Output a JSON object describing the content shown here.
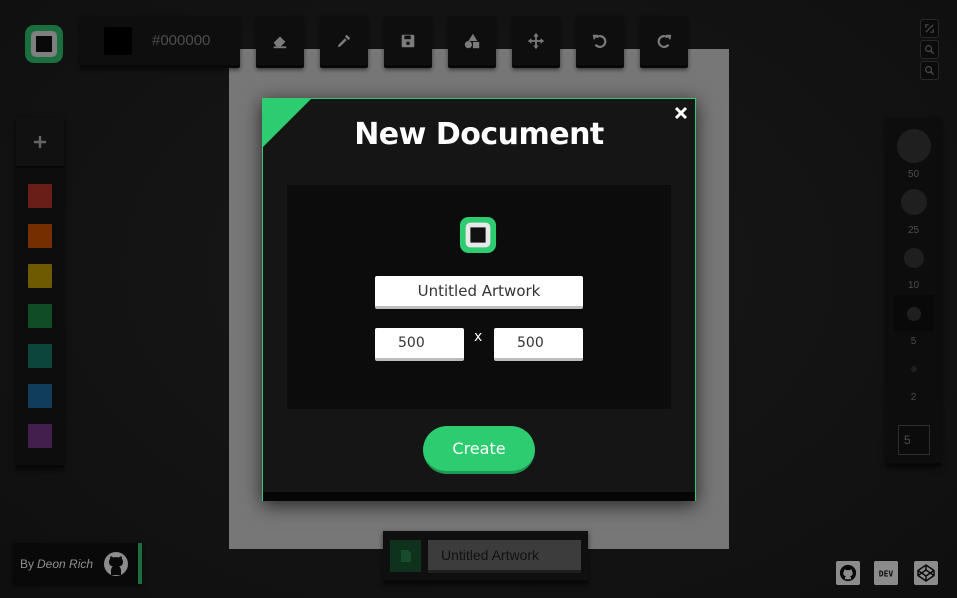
{
  "toolbar": {
    "hex_value": "#000000",
    "current_color": "#000000",
    "tools": [
      {
        "name": "eraser",
        "icon": "eraser-icon"
      },
      {
        "name": "eyedropper",
        "icon": "eyedropper-icon"
      },
      {
        "name": "save",
        "icon": "save-icon"
      },
      {
        "name": "shapes",
        "icon": "shapes-icon"
      },
      {
        "name": "move",
        "icon": "move-icon"
      },
      {
        "name": "undo",
        "icon": "undo-icon"
      },
      {
        "name": "redo",
        "icon": "redo-icon"
      }
    ]
  },
  "view_controls": [
    "fullscreen-icon",
    "zoom-in-icon",
    "zoom-out-icon"
  ],
  "palette": {
    "add_label": "+",
    "colors": [
      "#c0392b",
      "#d35400",
      "#c9a400",
      "#1e8c45",
      "#16806a",
      "#1f6fa8",
      "#7b3a8c"
    ]
  },
  "brushes": {
    "sizes": [
      "50",
      "25",
      "10",
      "5",
      "2"
    ],
    "selected": "5",
    "input_value": "5"
  },
  "author": {
    "by": "By",
    "name": "Deon Rich"
  },
  "document_tab": {
    "name": "Untitled Artwork"
  },
  "social": [
    "github-icon",
    "dev-icon",
    "codepen-icon"
  ],
  "modal": {
    "title": "New Document",
    "name_value": "Untitled Artwork",
    "width_value": "500",
    "height_value": "500",
    "separator": "x",
    "create_label": "Create",
    "accent": "#2ecc71"
  }
}
